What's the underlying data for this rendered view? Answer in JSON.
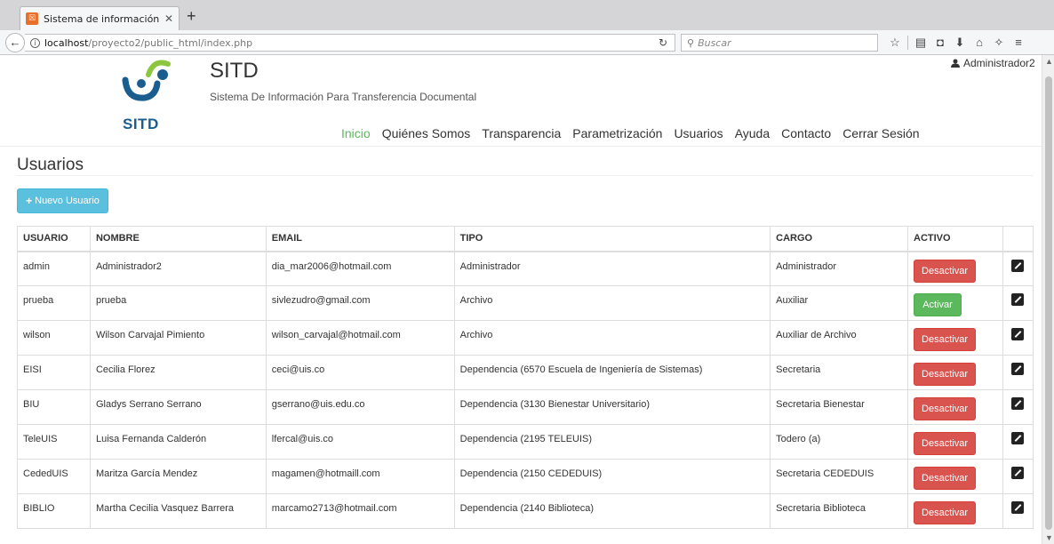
{
  "browser": {
    "tab_title": "Sistema de información par",
    "tab_favicon": "sitd-favicon",
    "url_host": "localhost",
    "url_path": "/proyecto2/public_html/index.php",
    "search_placeholder": "Buscar"
  },
  "header": {
    "logo_text": "SITD",
    "title": "SITD",
    "subtitle": "Sistema De Información Para Transferencia Documental",
    "user": "Administrador2"
  },
  "nav": {
    "items": [
      {
        "label": "Inicio"
      },
      {
        "label": "Quiénes Somos"
      },
      {
        "label": "Transparencia"
      },
      {
        "label": "Parametrización"
      },
      {
        "label": "Usuarios"
      },
      {
        "label": "Ayuda"
      },
      {
        "label": "Contacto"
      },
      {
        "label": "Cerrar Sesión"
      }
    ],
    "active_color": "#5cb85c"
  },
  "page": {
    "heading": "Usuarios",
    "new_button": "Nuevo Usuario"
  },
  "table": {
    "headers": [
      "USUARIO",
      "NOMBRE",
      "EMAIL",
      "TIPO",
      "CARGO",
      "ACTIVO"
    ],
    "rows": [
      {
        "usuario": "admin",
        "nombre": "Administrador2",
        "email": "dia_mar2006@hotmail.com",
        "tipo": "Administrador",
        "cargo": "Administrador",
        "accion": "Desactivar"
      },
      {
        "usuario": "prueba",
        "nombre": "prueba",
        "email": "sivlezudro@gmail.com",
        "tipo": "Archivo",
        "cargo": "Auxiliar",
        "accion": "Activar"
      },
      {
        "usuario": "wilson",
        "nombre": "Wilson Carvajal Pimiento",
        "email": "wilson_carvajal@hotmail.com",
        "tipo": "Archivo",
        "cargo": "Auxiliar de Archivo",
        "accion": "Desactivar"
      },
      {
        "usuario": "EISI",
        "nombre": "Cecilia Florez",
        "email": "ceci@uis.co",
        "tipo": "Dependencia (6570 Escuela de Ingeniería de Sistemas)",
        "cargo": "Secretaria",
        "accion": "Desactivar"
      },
      {
        "usuario": "BIU",
        "nombre": "Gladys Serrano Serrano",
        "email": "gserrano@uis.edu.co",
        "tipo": "Dependencia (3130 Bienestar Universitario)",
        "cargo": "Secretaria Bienestar",
        "accion": "Desactivar"
      },
      {
        "usuario": "TeleUIS",
        "nombre": "Luisa Fernanda Calderón",
        "email": "lfercal@uis.co",
        "tipo": "Dependencia (2195 TELEUIS)",
        "cargo": "Todero (a)",
        "accion": "Desactivar"
      },
      {
        "usuario": "CededUIS",
        "nombre": "Maritza García Mendez",
        "email": "magamen@hotmaill.com",
        "tipo": "Dependencia (2150 CEDEDUIS)",
        "cargo": "Secretaria CEDEDUIS",
        "accion": "Desactivar"
      },
      {
        "usuario": "BIBLIO",
        "nombre": "Martha Cecilia Vasquez Barrera",
        "email": "marcamo2713@hotmail.com",
        "tipo": "Dependencia (2140 Biblioteca)",
        "cargo": "Secretaria Biblioteca",
        "accion": "Desactivar"
      }
    ]
  },
  "colors": {
    "danger": "#d9534f",
    "success": "#5cb85c",
    "info": "#5bc0de"
  }
}
